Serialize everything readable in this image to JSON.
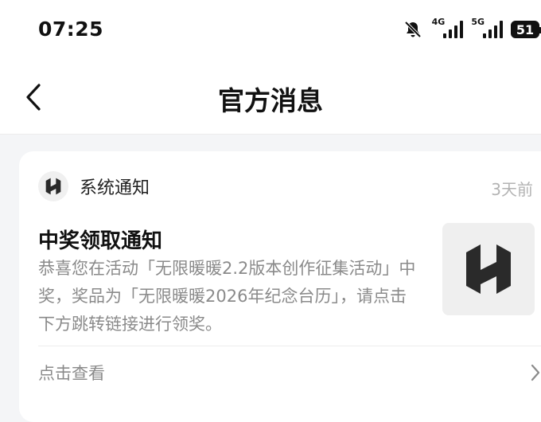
{
  "status_bar": {
    "time": "07:25",
    "net1": "4G",
    "net2": "5G",
    "battery": "51"
  },
  "nav": {
    "title": "官方消息"
  },
  "message": {
    "sender": "系统通知",
    "time": "3天前",
    "title": "中奖领取通知",
    "body": "恭喜您在活动「无限暖暖2.2版本创作征集活动」中奖，奖品为「无限暖暖2026年纪念台历」，请点击下方跳转链接进行领奖。",
    "action_label": "点击查看"
  },
  "icons": {
    "back": "chevron-left-icon",
    "mute": "bell-off-icon",
    "signal": "signal-bars-icon",
    "battery": "battery-icon",
    "logo": "infinity-nikki-logo",
    "forward": "chevron-right-icon"
  }
}
